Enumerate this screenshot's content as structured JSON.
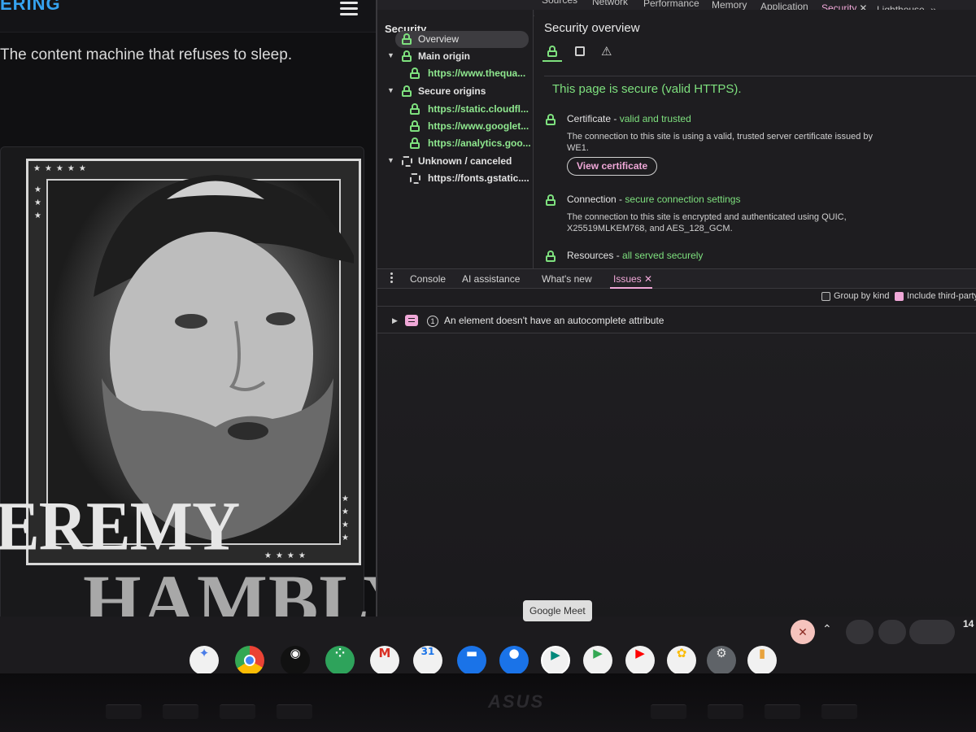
{
  "website": {
    "logo_text": "ERING",
    "tagline": "The content machine that refuses to sleep.",
    "poster_name_first": "EREMY",
    "poster_name_last": "HAMBLY"
  },
  "devtools": {
    "tabs": [
      "Sources",
      "Network",
      "Performance",
      "Memory",
      "Application",
      "Security",
      "Lighthouse"
    ],
    "active_tab": "Security",
    "overflow_icon": "double-chevron-right-icon",
    "sidebar": {
      "title": "Security",
      "overview": "Overview",
      "main_origin": {
        "label": "Main origin",
        "items": [
          "https://www.thequa..."
        ]
      },
      "secure_origins": {
        "label": "Secure origins",
        "items": [
          "https://static.cloudfl...",
          "https://www.googlet...",
          "https://analytics.goo..."
        ]
      },
      "unknown": {
        "label": "Unknown / canceled",
        "items": [
          "https://fonts.gstatic...."
        ]
      }
    },
    "overview": {
      "title": "Security overview",
      "banner": "This page is secure (valid HTTPS).",
      "certificate": {
        "label": "Certificate",
        "separator": " - ",
        "status": "valid and trusted",
        "description": "The connection to this site is using a valid, trusted server certificate issued by WE1.",
        "button": "View certificate"
      },
      "connection": {
        "label": "Connection",
        "separator": " - ",
        "status": "secure connection settings",
        "description": "The connection to this site is encrypted and authenticated using QUIC, X25519MLKEM768, and AES_128_GCM."
      },
      "resources": {
        "label": "Resources",
        "separator": " - ",
        "status": "all served securely"
      }
    },
    "drawer": {
      "tabs": [
        "Console",
        "AI assistance",
        "What's new",
        "Issues"
      ],
      "active_tab": "Issues",
      "group_by_kind": "Group by kind",
      "include_third_party": "Include third-party",
      "issue_count": "1",
      "issue_text": "An element doesn't have an autocomplete attribute"
    }
  },
  "shelf": {
    "tooltip": "Google Meet",
    "apps": [
      "Gemini",
      "Chrome",
      "Podcasts",
      "Apps",
      "Gmail",
      "Calendar",
      "Files",
      "Messages",
      "Google Meet",
      "Play Store",
      "YouTube",
      "Photos",
      "Settings",
      "Files app"
    ],
    "clock": "14"
  },
  "colors": {
    "accent_pink": "#f0a8d8",
    "secure_green": "#7ee07e",
    "devtools_bg": "#1e1d20"
  }
}
